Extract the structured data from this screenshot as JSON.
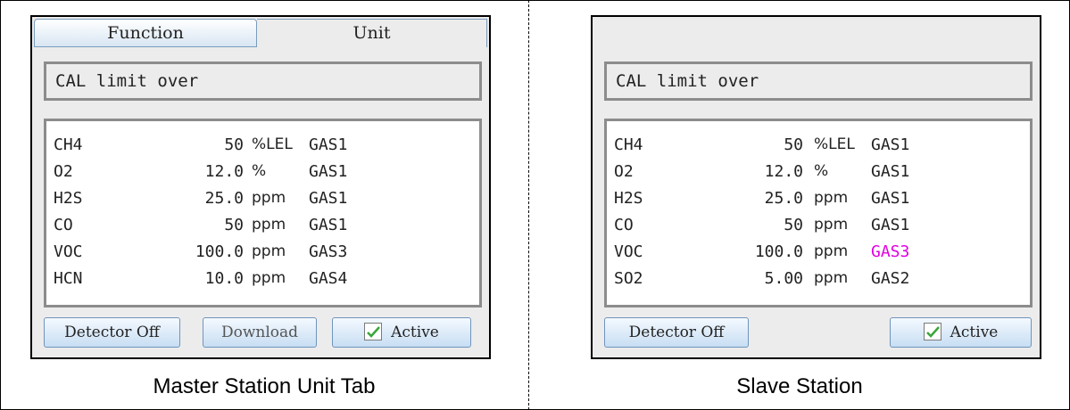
{
  "master": {
    "tabs": [
      {
        "label": "Function"
      },
      {
        "label": "Unit"
      }
    ],
    "status": "CAL limit over",
    "rows": [
      {
        "gas": "CH4",
        "value": "50",
        "unit": "%LEL",
        "group": "GAS1"
      },
      {
        "gas": "O2",
        "value": "12.0",
        "unit": "%",
        "group": "GAS1"
      },
      {
        "gas": "H2S",
        "value": "25.0",
        "unit": "ppm",
        "group": "GAS1"
      },
      {
        "gas": "CO",
        "value": "50",
        "unit": "ppm",
        "group": "GAS1"
      },
      {
        "gas": "VOC",
        "value": "100.0",
        "unit": "ppm",
        "group": "GAS3"
      },
      {
        "gas": "HCN",
        "value": "10.0",
        "unit": "ppm",
        "group": "GAS4"
      }
    ],
    "buttons": {
      "detector_off": "Detector Off",
      "download": "Download",
      "active": "Active"
    },
    "caption": "Master Station Unit Tab"
  },
  "slave": {
    "status": "CAL limit over",
    "rows": [
      {
        "gas": "CH4",
        "value": "50",
        "unit": "%LEL",
        "group": "GAS1"
      },
      {
        "gas": "O2",
        "value": "12.0",
        "unit": "%",
        "group": "GAS1"
      },
      {
        "gas": "H2S",
        "value": "25.0",
        "unit": "ppm",
        "group": "GAS1"
      },
      {
        "gas": "CO",
        "value": "50",
        "unit": "ppm",
        "group": "GAS1"
      },
      {
        "gas": "VOC",
        "value": "100.0",
        "unit": "ppm",
        "group": "GAS3",
        "highlight": true
      },
      {
        "gas": "SO2",
        "value": "5.00",
        "unit": "ppm",
        "group": "GAS2"
      }
    ],
    "buttons": {
      "detector_off": "Detector Off",
      "active": "Active"
    },
    "caption": "Slave Station"
  },
  "colors": {
    "highlight": "#e000e0",
    "button_border": "#6f95bd",
    "check": "#3aa63a"
  },
  "icons": {
    "active_check": "checkmark-icon"
  }
}
